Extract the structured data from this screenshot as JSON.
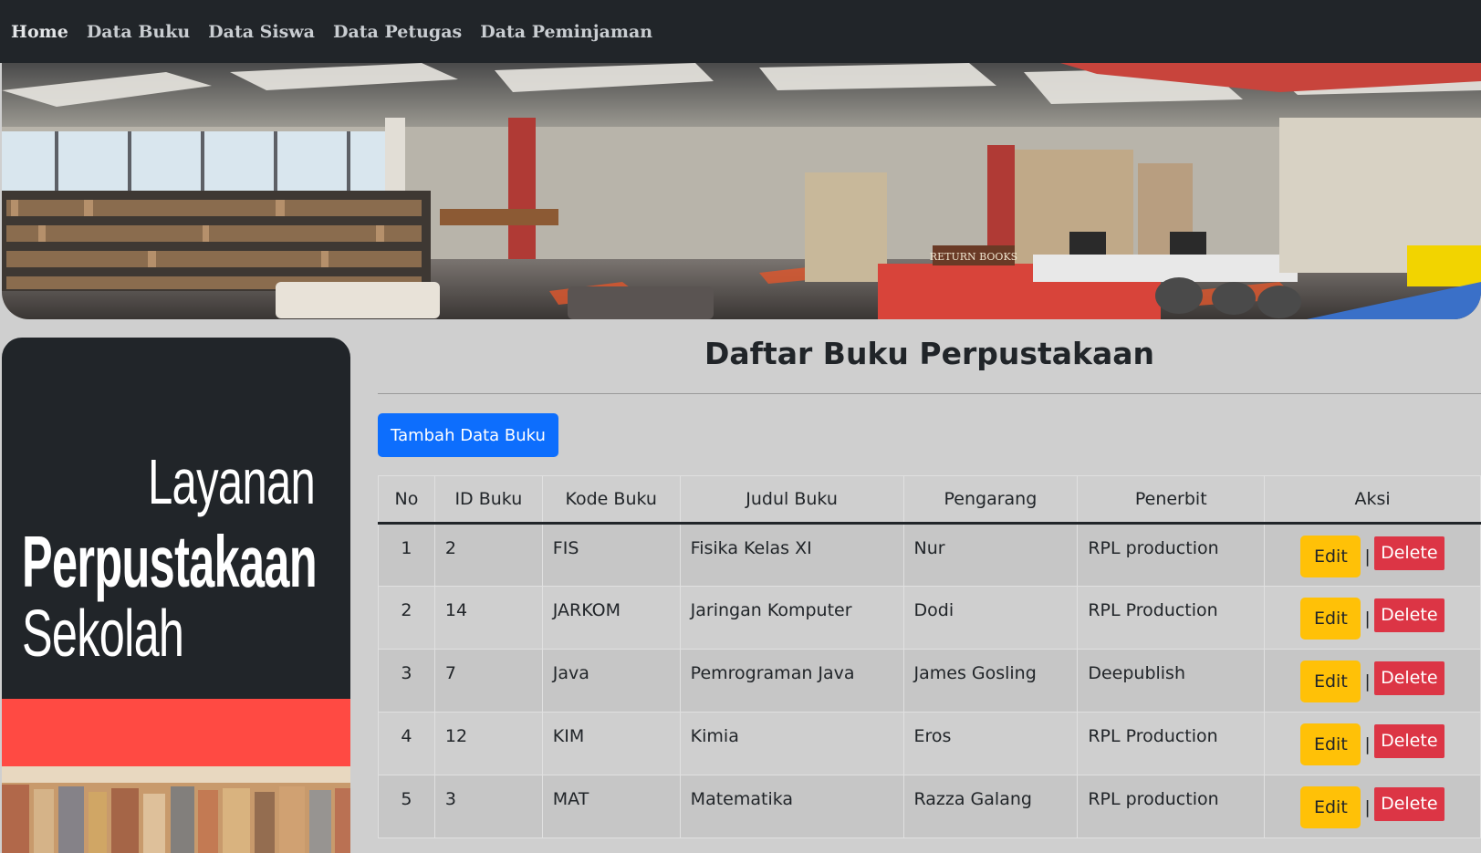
{
  "nav": {
    "items": [
      {
        "label": "Home"
      },
      {
        "label": "Data Buku"
      },
      {
        "label": "Data Siswa"
      },
      {
        "label": "Data Petugas"
      },
      {
        "label": "Data Peminjaman"
      }
    ]
  },
  "banner": {
    "sign_text": "RETURN BOOKS"
  },
  "sidebar": {
    "line1": "Layanan",
    "line2": "Perpustakaan",
    "line3": "Sekolah"
  },
  "main": {
    "title": "Daftar Buku Perpustakaan",
    "add_button": "Tambah Data Buku",
    "table": {
      "headers": [
        "No",
        "ID Buku",
        "Kode Buku",
        "Judul Buku",
        "Pengarang",
        "Penerbit",
        "Aksi"
      ],
      "rows": [
        {
          "no": "1",
          "id": "2",
          "kode": "FIS",
          "judul": "Fisika Kelas XI",
          "pengarang": "Nur",
          "penerbit": "RPL production",
          "edit": "Edit",
          "sep": "|",
          "delete": "Delete"
        },
        {
          "no": "2",
          "id": "14",
          "kode": "JARKOM",
          "judul": "Jaringan Komputer",
          "pengarang": "Dodi",
          "penerbit": "RPL Production",
          "edit": "Edit",
          "sep": "|",
          "delete": "Delete"
        },
        {
          "no": "3",
          "id": "7",
          "kode": "Java",
          "judul": "Pemrograman Java",
          "pengarang": "James Gosling",
          "penerbit": "Deepublish",
          "edit": "Edit",
          "sep": "|",
          "delete": "Delete"
        },
        {
          "no": "4",
          "id": "12",
          "kode": "KIM",
          "judul": "Kimia",
          "pengarang": "Eros",
          "penerbit": "RPL Production",
          "edit": "Edit",
          "sep": "|",
          "delete": "Delete"
        },
        {
          "no": "5",
          "id": "3",
          "kode": "MAT",
          "judul": "Matematika",
          "pengarang": "Razza Galang",
          "penerbit": "RPL production",
          "edit": "Edit",
          "sep": "|",
          "delete": "Delete"
        }
      ]
    }
  },
  "colors": {
    "navbar": "#212529",
    "primary": "#0d6efd",
    "warning": "#ffc107",
    "danger": "#dc3545",
    "sidebar_red": "#ff4a43",
    "page_bg": "#cfcfcf"
  }
}
